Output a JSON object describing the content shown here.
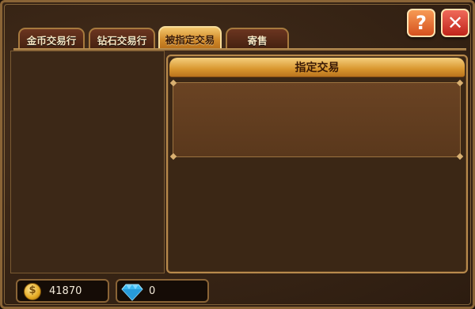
{
  "tabs": [
    {
      "label": "金币交易行",
      "active": false
    },
    {
      "label": "钻石交易行",
      "active": false
    },
    {
      "label": "被指定交易",
      "active": true
    },
    {
      "label": "寄售",
      "active": false
    }
  ],
  "panel": {
    "title": "指定交易"
  },
  "buttons": {
    "help": "?",
    "close": "✕"
  },
  "currency": {
    "gold": {
      "value": "41870",
      "icon": "gold-coin-icon"
    },
    "diamond": {
      "value": "0",
      "icon": "diamond-icon"
    }
  },
  "colors": {
    "accent_gold": "#d8962e",
    "frame": "#8a6436",
    "panel_bg": "#3b2715"
  }
}
